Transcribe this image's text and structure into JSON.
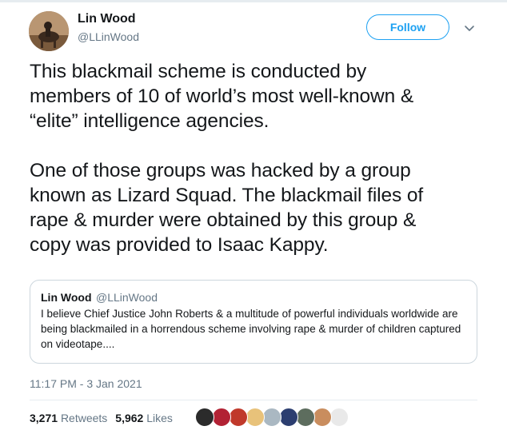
{
  "author": {
    "name": "Lin Wood",
    "handle": "@LLinWood"
  },
  "follow_label": "Follow",
  "tweet_text": "This blackmail scheme is conducted by\nmembers of 10 of world’s most well-known &\n“elite” intelligence agencies.\n\nOne of those groups was hacked by a group\nknown as Lizard Squad. The blackmail files of\nrape & murder were obtained by this group &\ncopy was provided to Isaac Kappy.",
  "quote": {
    "name": "Lin Wood",
    "handle": "@LLinWood",
    "text": "I believe Chief Justice John Roberts & a multitude of powerful individuals worldwide are being blackmailed in a horrendous scheme involving rape & murder of children captured on videotape...."
  },
  "timestamp": "11:17 PM - 3 Jan 2021",
  "stats": {
    "retweets_count": "3,271",
    "retweets_label": "Retweets",
    "likes_count": "5,962",
    "likes_label": "Likes"
  },
  "likers": [
    {
      "icon": "avatar-dark-badge",
      "color": "#2b2b2b"
    },
    {
      "icon": "avatar-flag",
      "color": "#b22234"
    },
    {
      "icon": "avatar-red-logo",
      "color": "#c0392b"
    },
    {
      "icon": "avatar-blonde",
      "color": "#e8c27a"
    },
    {
      "icon": "avatar-default",
      "color": "#aab8c2"
    },
    {
      "icon": "avatar-blue-dark",
      "color": "#2c3e70"
    },
    {
      "icon": "avatar-landscape",
      "color": "#5d6d5e"
    },
    {
      "icon": "avatar-woman",
      "color": "#c98d5e"
    },
    {
      "icon": "avatar-panda",
      "color": "#e9e9e9"
    }
  ]
}
